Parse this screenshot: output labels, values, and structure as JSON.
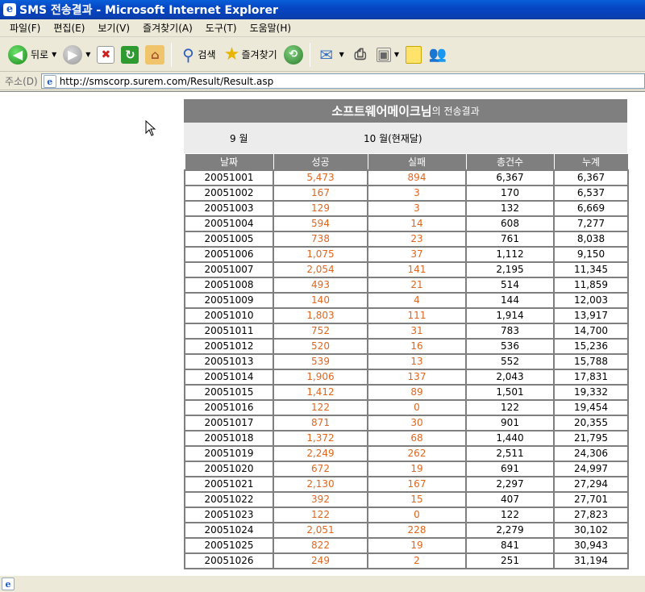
{
  "window": {
    "title": "SMS 전송결과 - Microsoft Internet Explorer"
  },
  "menu": [
    "파일(F)",
    "편집(E)",
    "보기(V)",
    "즐겨찾기(A)",
    "도구(T)",
    "도움말(H)"
  ],
  "toolbar": {
    "back_label": "뒤로",
    "search_label": "검색",
    "favorites_label": "즐겨찾기"
  },
  "address": {
    "label": "주소(D)",
    "url": "http://smscorp.surem.com/Result/Result.asp"
  },
  "result": {
    "title_main": "소프트웨어메이크님",
    "title_suffix": "의 전송결과",
    "month_prev": "9 월",
    "month_current": "10 월(현재달)",
    "columns": [
      "날짜",
      "성공",
      "실패",
      "총건수",
      "누계"
    ],
    "rows": [
      [
        "20051001",
        "5,473",
        "894",
        "6,367",
        "6,367"
      ],
      [
        "20051002",
        "167",
        "3",
        "170",
        "6,537"
      ],
      [
        "20051003",
        "129",
        "3",
        "132",
        "6,669"
      ],
      [
        "20051004",
        "594",
        "14",
        "608",
        "7,277"
      ],
      [
        "20051005",
        "738",
        "23",
        "761",
        "8,038"
      ],
      [
        "20051006",
        "1,075",
        "37",
        "1,112",
        "9,150"
      ],
      [
        "20051007",
        "2,054",
        "141",
        "2,195",
        "11,345"
      ],
      [
        "20051008",
        "493",
        "21",
        "514",
        "11,859"
      ],
      [
        "20051009",
        "140",
        "4",
        "144",
        "12,003"
      ],
      [
        "20051010",
        "1,803",
        "111",
        "1,914",
        "13,917"
      ],
      [
        "20051011",
        "752",
        "31",
        "783",
        "14,700"
      ],
      [
        "20051012",
        "520",
        "16",
        "536",
        "15,236"
      ],
      [
        "20051013",
        "539",
        "13",
        "552",
        "15,788"
      ],
      [
        "20051014",
        "1,906",
        "137",
        "2,043",
        "17,831"
      ],
      [
        "20051015",
        "1,412",
        "89",
        "1,501",
        "19,332"
      ],
      [
        "20051016",
        "122",
        "0",
        "122",
        "19,454"
      ],
      [
        "20051017",
        "871",
        "30",
        "901",
        "20,355"
      ],
      [
        "20051018",
        "1,372",
        "68",
        "1,440",
        "21,795"
      ],
      [
        "20051019",
        "2,249",
        "262",
        "2,511",
        "24,306"
      ],
      [
        "20051020",
        "672",
        "19",
        "691",
        "24,997"
      ],
      [
        "20051021",
        "2,130",
        "167",
        "2,297",
        "27,294"
      ],
      [
        "20051022",
        "392",
        "15",
        "407",
        "27,701"
      ],
      [
        "20051023",
        "122",
        "0",
        "122",
        "27,823"
      ],
      [
        "20051024",
        "2,051",
        "228",
        "2,279",
        "30,102"
      ],
      [
        "20051025",
        "822",
        "19",
        "841",
        "30,943"
      ],
      [
        "20051026",
        "249",
        "2",
        "251",
        "31,194"
      ]
    ]
  }
}
